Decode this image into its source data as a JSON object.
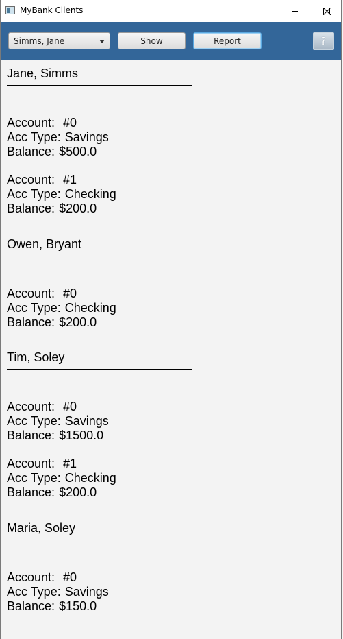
{
  "window": {
    "title": "MyBank Clients"
  },
  "toolbar": {
    "client_select_value": "Simms, Jane",
    "show_label": "Show",
    "report_label": "Report",
    "help_label": "?"
  },
  "labels": {
    "account": "Account:",
    "acc_type": "Acc Type:",
    "balance": "Balance:",
    "rule": "____________________________"
  },
  "clients": [
    {
      "name": "Jane, Simms",
      "accounts": [
        {
          "number": "#0",
          "type": "Savings",
          "balance": "$500.0"
        },
        {
          "number": "#1",
          "type": "Checking",
          "balance": "$200.0"
        }
      ]
    },
    {
      "name": "Owen, Bryant",
      "accounts": [
        {
          "number": "#0",
          "type": "Checking",
          "balance": "$200.0"
        }
      ]
    },
    {
      "name": "Tim, Soley",
      "accounts": [
        {
          "number": "#0",
          "type": "Savings",
          "balance": "$1500.0"
        },
        {
          "number": "#1",
          "type": "Checking",
          "balance": "$200.0"
        }
      ]
    },
    {
      "name": "Maria, Soley",
      "accounts": [
        {
          "number": "#0",
          "type": "Savings",
          "balance": "$150.0"
        }
      ]
    }
  ],
  "colors": {
    "toolbar_bg": "#336699",
    "content_bg": "#f3f3f3",
    "titlebar_bg": "#ffffff"
  }
}
